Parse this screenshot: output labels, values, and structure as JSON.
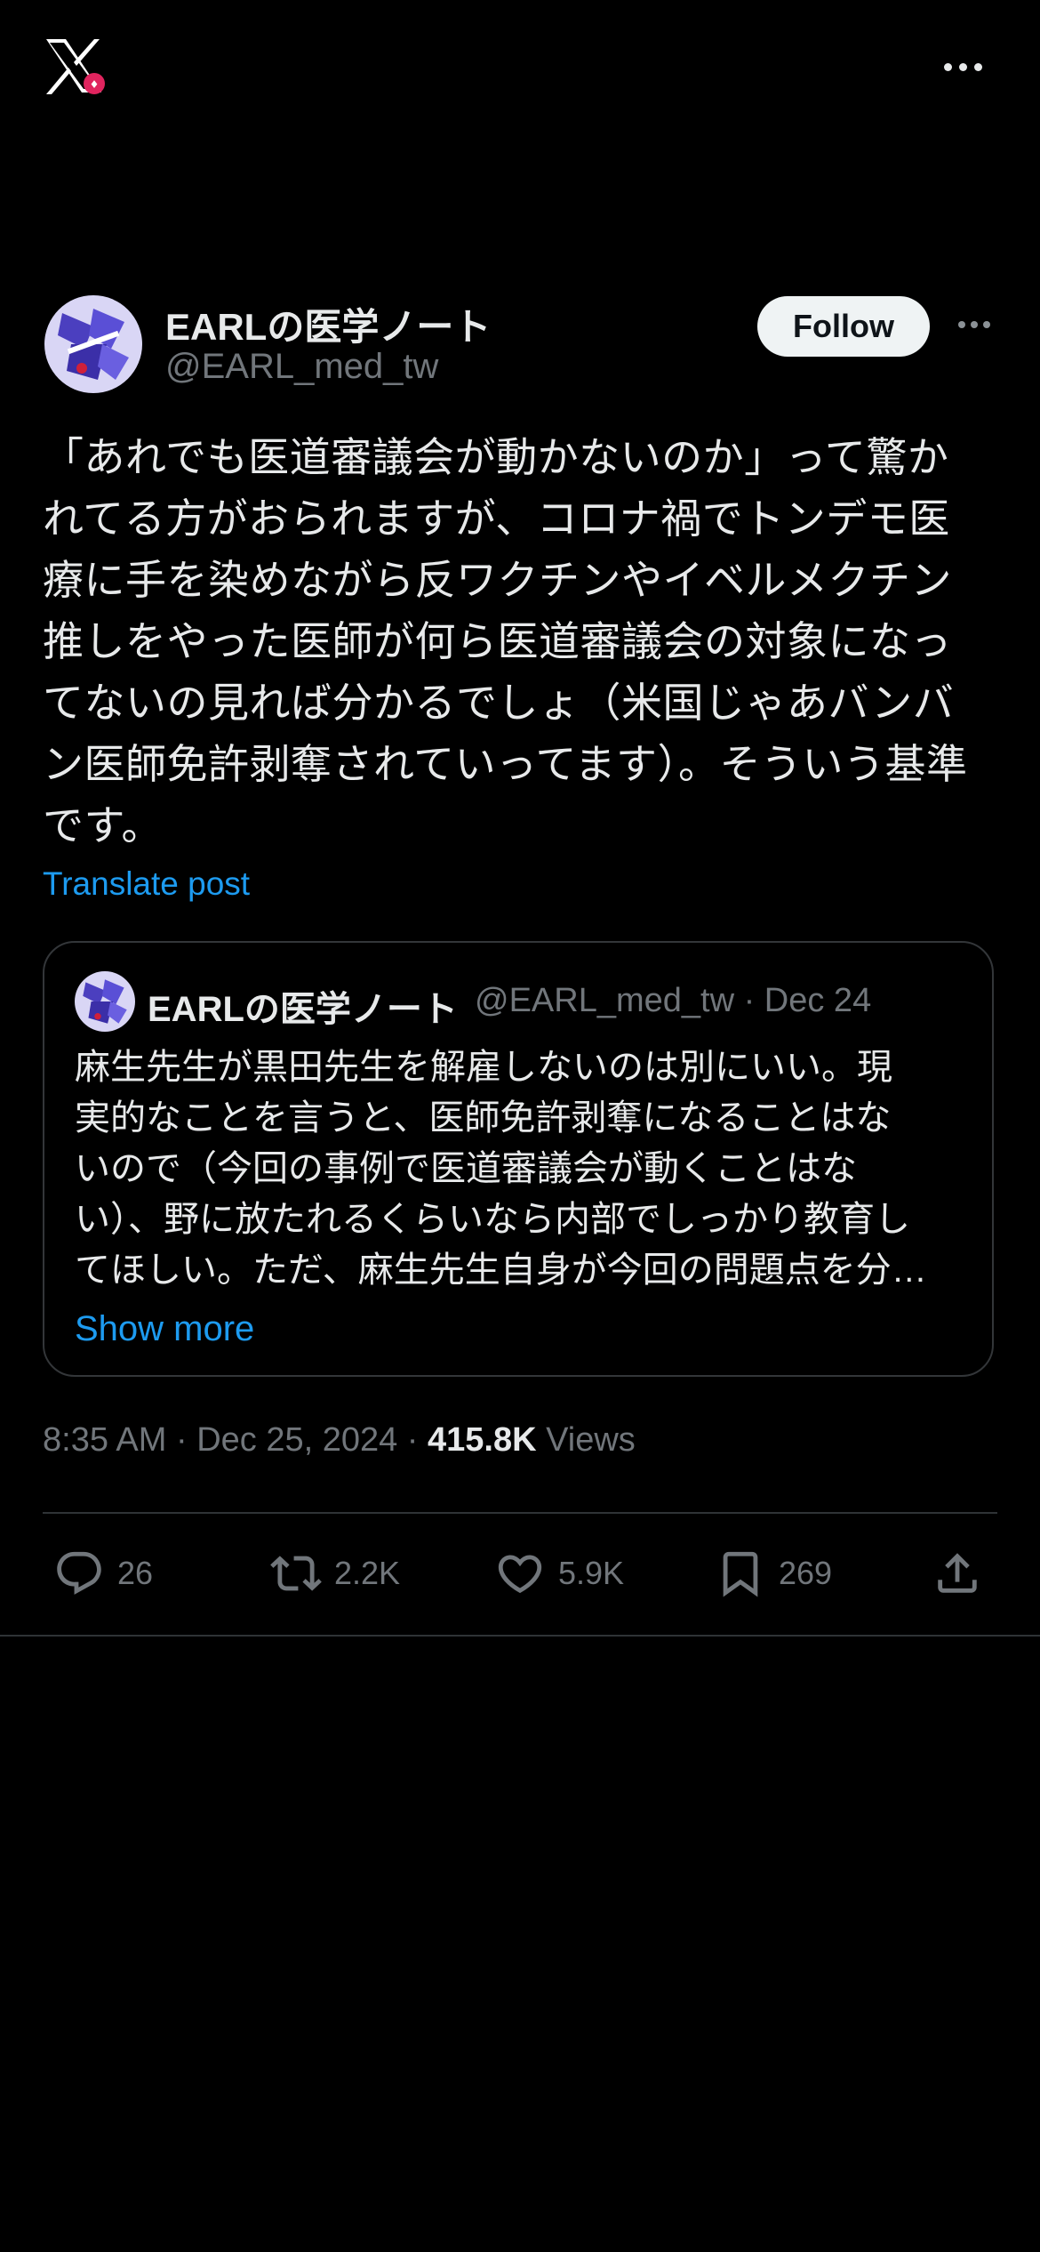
{
  "topbar": {
    "logo": "x-logo-icon",
    "more": "more-icon"
  },
  "tweet": {
    "author_name": "EARLの医学ノート",
    "author_handle": "@EARL_med_tw",
    "follow_label": "Follow",
    "text": "「あれでも医道審議会が動かないのか」って驚か\nれてる方がおられますが、コロナ禍でトンデモ医\n療に手を染めながら反ワクチンやイベルメクチン\n推しをやった医師が何ら医道審議会の対象になっ\nてないの見れば分かるでしょ（米国じゃあバンバ\nン医師免許剥奪されていってます）。そういう基準\nです。",
    "translate_label": "Translate post",
    "quote": {
      "author_name": "EARLの医学ノート",
      "meta": "@EARL_med_tw · Dec 24",
      "text": "麻生先生が黒田先生を解雇しないのは別にいい。現\n実的なことを言うと、医師免許剥奪になることはな\nいので（今回の事例で医道審議会が動くことはな\nい）、野に放たれるくらいなら内部でしっかり教育し\nてほしい。ただ、麻生先生自身が今回の問題点を分…",
      "show_more_label": "Show more"
    },
    "time": "8:35 AM · Dec 25, 2024 · ",
    "views_count": "415.8K",
    "views_label": "Views",
    "actions": {
      "replies": "26",
      "reposts": "2.2K",
      "likes": "5.9K",
      "bookmarks": "269"
    }
  },
  "colors": {
    "accent": "#1d9bf0",
    "background": "#000000",
    "text": "#e7e9ea",
    "muted": "#71767b"
  }
}
